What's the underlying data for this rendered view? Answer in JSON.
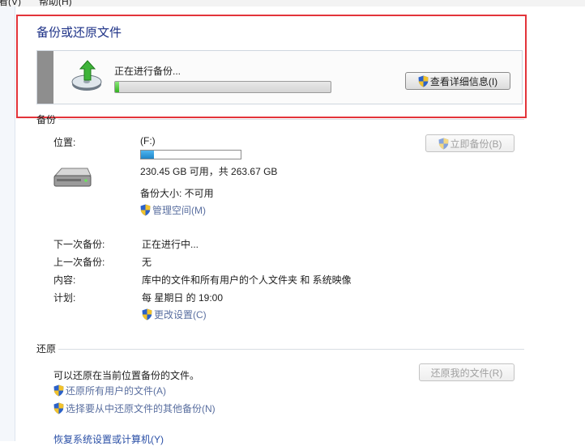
{
  "menubar": {
    "items": [
      "查看(V)",
      "帮助(H)"
    ]
  },
  "header": {
    "title": "备份或还原文件"
  },
  "progress": {
    "status": "正在进行备份...",
    "fraction": 0.02,
    "details_button": "查看详细信息(I)"
  },
  "backup": {
    "section_title": "备份",
    "location_label": "位置:",
    "drive": "(F:)",
    "capacity_used_fraction": 0.13,
    "free_space": "230.45 GB 可用，共 263.67 GB",
    "size_label": "备份大小: 不可用",
    "manage_space_link": "管理空间(M)",
    "backup_now_button": "立即备份(B)",
    "info_rows": [
      {
        "label": "下一次备份:",
        "value": "正在进行中..."
      },
      {
        "label": "上一次备份:",
        "value": "无"
      },
      {
        "label": "内容:",
        "value": "库中的文件和所有用户的个人文件夹 和 系统映像"
      },
      {
        "label": "计划:",
        "value": "每 星期日 的 19:00"
      }
    ],
    "change_settings_link": "更改设置(C)"
  },
  "restore": {
    "section_title": "还原",
    "description": "可以还原在当前位置备份的文件。",
    "restore_my_files_button": "还原我的文件(R)",
    "restore_all_users_link": "还原所有用户的文件(A)",
    "select_other_backup_link": "选择要从中还原文件的其他备份(N)",
    "recover_system_link": "恢复系统设置或计算机(Y)"
  },
  "colors": {
    "highlight_frame": "#e3343a",
    "progress_green": "#33b31f",
    "title_blue": "#1e3287"
  }
}
